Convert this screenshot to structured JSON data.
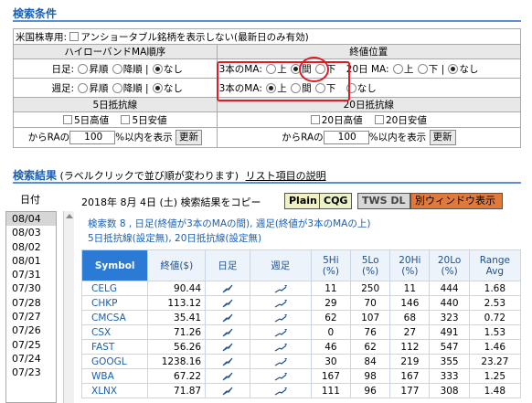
{
  "search_conditions": {
    "title": "検索条件",
    "us_stock_label": "米国株専用:",
    "us_stock_checkbox": "アンショータブル銘柄を表示しない(最新日のみ有効)",
    "hilo_band_header": "ハイローバンドMA順序",
    "close_position_header": "終値位置",
    "daily_label": "日足:",
    "weekly_label": "週足:",
    "opt_up": "昇順",
    "opt_down": "降順",
    "opt_none": "なし",
    "ma3_label": "3本のMA:",
    "ma20_label": "20日 MA:",
    "pos_above": "上",
    "pos_between": "間",
    "pos_below": "下",
    "pos_none": "なし",
    "sep": "|",
    "band5_header": "5日抵抗線",
    "band20_header": "20日抵抗線",
    "high5": "5日高値",
    "low5": "5日安値",
    "high20": "20日高値",
    "low20": "20日安値",
    "ra_prefix": "からRAの",
    "ra_value": "100",
    "ra_suffix": "%以内を表示",
    "update_button": "更新"
  },
  "results": {
    "title": "検索結果",
    "title_note": "(ラベルクリックで並び順が変わります)",
    "list_help_link": "リスト項目の説明",
    "dates_label": "日付",
    "dates": [
      "08/04",
      "08/03",
      "08/02",
      "08/01",
      "07/31",
      "07/30",
      "07/28",
      "07/27",
      "07/26",
      "07/25",
      "07/24",
      "07/23"
    ],
    "selected_date_index": 0,
    "date_heading": "2018年 8月 4日 (土) 検索結果をコピー",
    "btn_plain": "Plain",
    "btn_cqg": "CQG",
    "btn_tws": "TWS DL",
    "btn_window": "別ウィンドウ表示",
    "summary_line1": "検索数 8 , 日足(終値が3本のMAの間), 週足(終値が3本のMAの上)",
    "summary_line2": "5日抵抗線(設定無), 20日抵抗線(設定無)",
    "columns": {
      "symbol": "Symbol",
      "close": "終値($)",
      "daily": "日足",
      "weekly": "週足",
      "hi5": "5Hi",
      "lo5": "5Lo",
      "hi20": "20Hi",
      "lo20": "20Lo",
      "pct": "(%)",
      "range": "Range",
      "avg": "Avg"
    },
    "rows": [
      {
        "symbol": "CELG",
        "close": "90.44",
        "hi5": "11",
        "lo5": "250",
        "hi20": "11",
        "lo20": "444",
        "range": "1.68"
      },
      {
        "symbol": "CHKP",
        "close": "113.12",
        "hi5": "29",
        "lo5": "70",
        "hi20": "146",
        "lo20": "440",
        "range": "2.53"
      },
      {
        "symbol": "CMCSA",
        "close": "35.41",
        "hi5": "62",
        "lo5": "107",
        "hi20": "68",
        "lo20": "323",
        "range": "0.72"
      },
      {
        "symbol": "CSX",
        "close": "71.26",
        "hi5": "0",
        "lo5": "76",
        "hi20": "27",
        "lo20": "491",
        "range": "1.53"
      },
      {
        "symbol": "FAST",
        "close": "56.26",
        "hi5": "46",
        "lo5": "62",
        "hi20": "112",
        "lo20": "547",
        "range": "1.46"
      },
      {
        "symbol": "GOOGL",
        "close": "1238.16",
        "hi5": "30",
        "lo5": "84",
        "hi20": "219",
        "lo20": "355",
        "range": "23.27"
      },
      {
        "symbol": "WBA",
        "close": "67.22",
        "hi5": "167",
        "lo5": "98",
        "hi20": "167",
        "lo20": "333",
        "range": "1.25"
      },
      {
        "symbol": "XLNX",
        "close": "71.87",
        "hi5": "111",
        "lo5": "96",
        "hi20": "177",
        "lo20": "308",
        "range": "1.48"
      }
    ]
  },
  "colors": {
    "title_blue": "#1a5fb4",
    "highlight_red": "#e01b24",
    "header_blue": "#2b7bd6",
    "window_button": "#e07a3c"
  }
}
